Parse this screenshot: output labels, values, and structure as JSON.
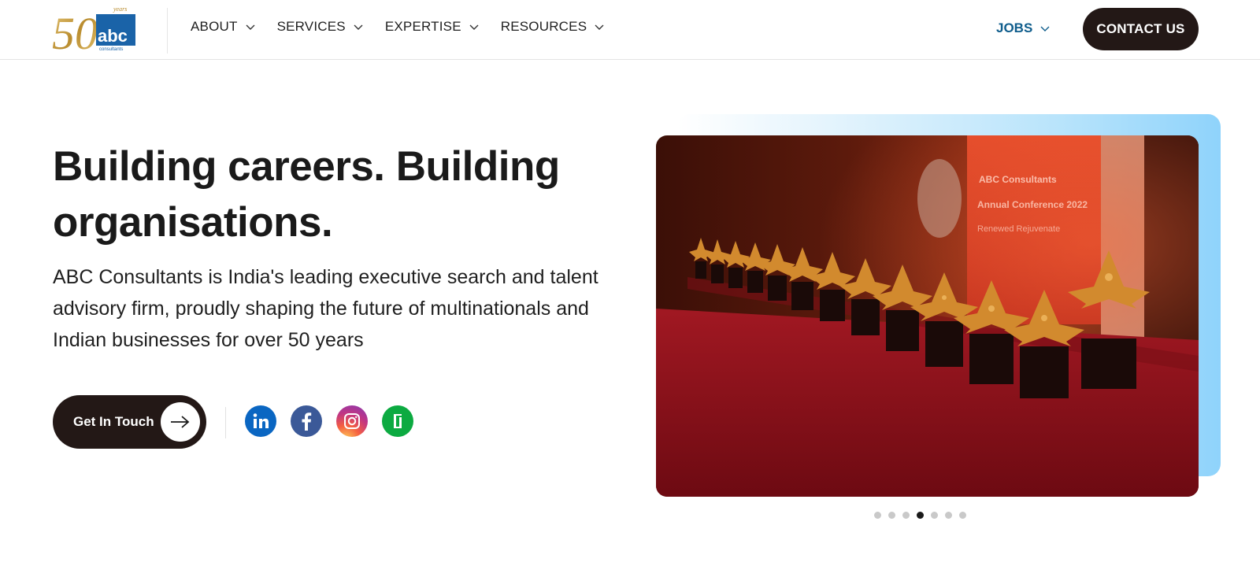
{
  "header": {
    "logo": {
      "number": "50",
      "tagline": "years",
      "brand": "abc",
      "sub": "consultants"
    },
    "nav": [
      {
        "label": "ABOUT"
      },
      {
        "label": "SERVICES"
      },
      {
        "label": "EXPERTISE"
      },
      {
        "label": "RESOURCES"
      }
    ],
    "jobs_label": "JOBS",
    "contact_label": "CONTACT US"
  },
  "hero": {
    "headline_line1": "Building careers. Building",
    "headline_line2": "organisations.",
    "description": "ABC Consultants is India's leading executive search and talent advisory firm, proudly shaping the future of multinationals and Indian businesses for over 50 years",
    "cta_label": "Get In Touch",
    "social_icons": [
      "linkedin-icon",
      "facebook-icon",
      "instagram-icon",
      "glassdoor-icon"
    ],
    "banner": {
      "line1": "ABC Consultants",
      "line2": "Annual Conference 2022",
      "line3": "Renewed Rejuvenate"
    }
  },
  "carousel": {
    "total": 7,
    "active_index": 3
  },
  "colors": {
    "dark": "#231816",
    "accent_blue": "#0f5d8c",
    "linkedin": "#0a66c2",
    "facebook": "#3b5998",
    "glassdoor": "#0caa41",
    "gold": "#c9a34a"
  }
}
